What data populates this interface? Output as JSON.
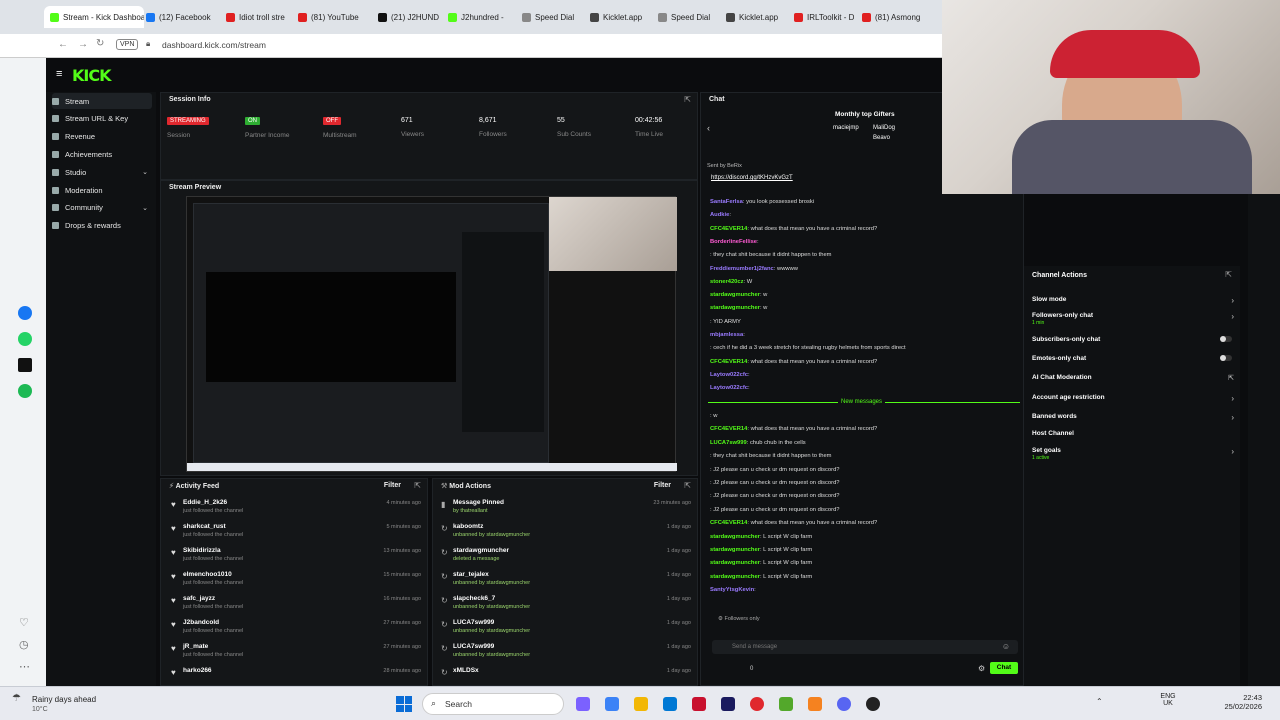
{
  "browser": {
    "tabs": [
      {
        "label": "Stream - Kick Dashboa",
        "color": "#53fc18"
      },
      {
        "label": "(12) Facebook",
        "color": "#1877f2"
      },
      {
        "label": "Idiot troll stre",
        "color": "#e02020"
      },
      {
        "label": "(81) YouTube",
        "color": "#e02020"
      },
      {
        "label": "(21) J2HUND",
        "color": "#111111"
      },
      {
        "label": "J2hundred - ",
        "color": "#53fc18"
      },
      {
        "label": "Speed Dial",
        "color": "#888888"
      },
      {
        "label": "Kicklet.app",
        "color": "#444444"
      },
      {
        "label": "Speed Dial",
        "color": "#888888"
      },
      {
        "label": "Kicklet.app",
        "color": "#444444"
      },
      {
        "label": "IRLToolkit - D",
        "color": "#e02020"
      },
      {
        "label": "(81) Asmong",
        "color": "#e02020"
      }
    ],
    "url": "dashboard.kick.com/stream",
    "vpn": "VPN"
  },
  "logo": "KICK",
  "nav": {
    "items": [
      {
        "label": "Stream",
        "chev": ""
      },
      {
        "label": "Stream URL & Key",
        "chev": ""
      },
      {
        "label": "Revenue",
        "chev": ""
      },
      {
        "label": "Achievements",
        "chev": ""
      },
      {
        "label": "Studio",
        "chev": "⌄"
      },
      {
        "label": "Moderation",
        "chev": ""
      },
      {
        "label": "Community",
        "chev": "⌄"
      },
      {
        "label": "Drops & rewards",
        "chev": ""
      }
    ]
  },
  "session": {
    "title": "Session Info",
    "stats": [
      {
        "value": "STREAMING",
        "label": "Session",
        "badge": "#e0282e"
      },
      {
        "value": "ON",
        "label": "Partner Income",
        "badge": "#2eae32"
      },
      {
        "value": "OFF",
        "label": "Multistream",
        "badge": "#e0282e"
      },
      {
        "value": "671",
        "label": "Viewers",
        "badge": ""
      },
      {
        "value": "8,671",
        "label": "Followers",
        "badge": ""
      },
      {
        "value": "55",
        "label": "Sub Counts",
        "badge": ""
      },
      {
        "value": "00:42:56",
        "label": "Time Live",
        "badge": ""
      }
    ]
  },
  "preview": {
    "title": "Stream Preview"
  },
  "activity": {
    "title": "Activity Feed",
    "filter": "Filter",
    "items": [
      {
        "name": "Eddie_H_2k26",
        "sub": "just followed the channel",
        "time": "4 minutes ago"
      },
      {
        "name": "sharkcat_rust",
        "sub": "just followed the channel",
        "time": "5 minutes ago"
      },
      {
        "name": "Skibidirizzla",
        "sub": "just followed the channel",
        "time": "13 minutes ago"
      },
      {
        "name": "elmenchoo1010",
        "sub": "just followed the channel",
        "time": "15 minutes ago"
      },
      {
        "name": "safc_jayzz",
        "sub": "just followed the channel",
        "time": "16 minutes ago"
      },
      {
        "name": "J2bandcold",
        "sub": "just followed the channel",
        "time": "27 minutes ago"
      },
      {
        "name": "jR_mate",
        "sub": "just followed the channel",
        "time": "27 minutes ago"
      },
      {
        "name": "harko266",
        "sub": "",
        "time": "28 minutes ago"
      }
    ]
  },
  "modactions": {
    "title": "Mod Actions",
    "filter": "Filter",
    "items": [
      {
        "name": "Message Pinned",
        "sub": "by thatreallant",
        "time": "23 minutes ago"
      },
      {
        "name": "kaboomtz",
        "sub": "unbanned by stardawgmuncher",
        "time": "1 day ago"
      },
      {
        "name": "stardawgmuncher",
        "sub": "deleted a message",
        "time": "1 day ago"
      },
      {
        "name": "star_tejalex",
        "sub": "unbanned by stardawgmuncher",
        "time": "1 day ago"
      },
      {
        "name": "slapcheck6_7",
        "sub": "unbanned by stardawgmuncher",
        "time": "1 day ago"
      },
      {
        "name": "LUCA7sw999",
        "sub": "unbanned by stardawgmuncher",
        "time": "1 day ago"
      },
      {
        "name": "LUCA7sw999",
        "sub": "unbanned by stardawgmuncher",
        "time": "1 day ago"
      },
      {
        "name": "xMLDSx",
        "sub": "",
        "time": "1 day ago"
      }
    ]
  },
  "chat": {
    "title": "Chat",
    "gifters_title": "Monthly top Gifters",
    "gifters": [
      "maciejmp",
      "MaliDog",
      "Beavo"
    ],
    "pinned_by": "Sent by BeRix",
    "pinned_link": "https://discord.gg/tKHzvKvGzT",
    "messages": [
      {
        "user": "SantaFerlsa",
        "text": ": you look possessed broski",
        "cls": "u3"
      },
      {
        "user": "Audkie",
        "text": ":",
        "cls": "u3"
      },
      {
        "user": "CFC4EVER14",
        "text": ": what does that mean you have a criminal record?",
        "cls": "u1"
      },
      {
        "user": "BorderlineFellise",
        "text": ":",
        "cls": "u2"
      },
      {
        "user": "",
        "text": ": they chat shit because it didnt happen to them",
        "cls": "u4"
      },
      {
        "user": "Freddiemumber1j2fanc",
        "text": ": wwwww",
        "cls": "u3"
      },
      {
        "user": "stoner420cz",
        "text": ": W",
        "cls": "u1"
      },
      {
        "user": "stardawgmuncher",
        "text": ": w",
        "cls": "u1"
      },
      {
        "user": "stardawgmuncher",
        "text": ": w",
        "cls": "u1"
      },
      {
        "user": "",
        "text": ": YID ARMY",
        "cls": "u4"
      },
      {
        "user": "mbjamlessa",
        "text": ":",
        "cls": "u3"
      },
      {
        "user": "",
        "text": ": cech if he did a 3 week stretch for stealing rugby helmets from sports direct",
        "cls": "u4"
      },
      {
        "user": "CFC4EVER14",
        "text": ": what does that mean you have a criminal record?",
        "cls": "u1"
      },
      {
        "user": "Laytow022cfc",
        "text": ":",
        "cls": "u3"
      },
      {
        "user": "Laytow022cfc",
        "text": ":",
        "cls": "u3"
      }
    ],
    "new_messages": "New messages",
    "messages2": [
      {
        "user": "",
        "text": ": w",
        "cls": "u4"
      },
      {
        "user": "CFC4EVER14",
        "text": ": what does that mean you have a criminal record?",
        "cls": "u1"
      },
      {
        "user": "LUCA7sw999",
        "text": ": chub chub in the cells",
        "cls": "u1"
      },
      {
        "user": "",
        "text": ": they chat shit because it didnt happen to them",
        "cls": "u4"
      },
      {
        "user": "",
        "text": ": J2 please can u check ur dm request on discord?",
        "cls": "u4"
      },
      {
        "user": "",
        "text": ": J2 please can u check ur dm request on discord?",
        "cls": "u4"
      },
      {
        "user": "",
        "text": ": J2 please can u check ur dm request on discord?",
        "cls": "u4"
      },
      {
        "user": "",
        "text": ": J2 please can u check ur dm request on discord?",
        "cls": "u4"
      },
      {
        "user": "CFC4EVER14",
        "text": ": what does that mean you have a criminal record?",
        "cls": "u1"
      },
      {
        "user": "stardawgmuncher",
        "text": ": L script W clip farm",
        "cls": "u1"
      },
      {
        "user": "stardawgmuncher",
        "text": ": L script W clip farm",
        "cls": "u1"
      },
      {
        "user": "stardawgmuncher",
        "text": ": L script W clip farm",
        "cls": "u1"
      },
      {
        "user": "stardawgmuncher",
        "text": ": L script W clip farm",
        "cls": "u1"
      },
      {
        "user": "SantyYtsgKevin",
        "text": ":",
        "cls": "u3"
      }
    ],
    "followers_only": "Followers only",
    "placeholder": "Send a message",
    "count": "0",
    "send": "Chat"
  },
  "channel_actions": {
    "title": "Channel Actions",
    "items": [
      {
        "label": "Slow mode",
        "sub": "",
        "control": "chev"
      },
      {
        "label": "Followers-only chat",
        "sub": "1 min",
        "control": "chev"
      },
      {
        "label": "Subscribers-only chat",
        "sub": "",
        "control": "toggle"
      },
      {
        "label": "Emotes-only chat",
        "sub": "",
        "control": "toggle"
      },
      {
        "label": "AI Chat Moderation",
        "sub": "",
        "control": "ext"
      },
      {
        "label": "Account age restriction",
        "sub": "",
        "control": "chev"
      },
      {
        "label": "Banned words",
        "sub": "",
        "control": "chev"
      },
      {
        "label": "Host Channel",
        "sub": "",
        "control": ""
      },
      {
        "label": "Set goals",
        "sub": "1 active",
        "control": "chev"
      }
    ]
  },
  "taskbar": {
    "weather": "Rainy days ahead",
    "temp": "10°C",
    "search": "Search",
    "lang": "ENG",
    "region": "UK",
    "time": "22:43",
    "date": "25/02/2026"
  }
}
